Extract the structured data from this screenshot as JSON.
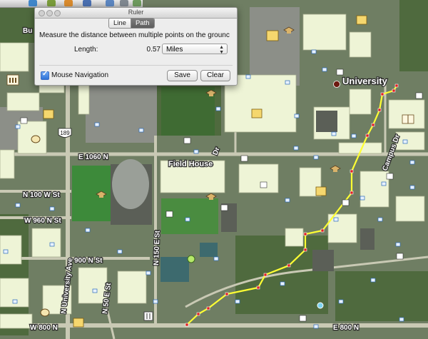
{
  "ruler": {
    "title": "Ruler",
    "tabs": [
      {
        "label": "Line",
        "active": false
      },
      {
        "label": "Path",
        "active": true
      }
    ],
    "description": "Measure the distance between multiple points on the grounc",
    "length_label": "Length:",
    "length_value": "0.57",
    "units_selected": "Miles",
    "mouse_navigation_label": "Mouse Navigation",
    "mouse_navigation_checked": true,
    "save_label": "Save",
    "clear_label": "Clear"
  },
  "map": {
    "place_labels": {
      "university": "University",
      "field_house": "Field House",
      "campus_dr": "Campus Dr",
      "byu_fragment": "Bu",
      "route_shield": "189"
    },
    "streets": {
      "e1060n": "E 1060 N",
      "n100w": "N 100 W St",
      "w960n": "W 960 N St",
      "n900n": "900 N St",
      "w800n": "W 800 N",
      "e800n": "E 800 N",
      "n_university_ave": "N University Ave",
      "n50e": "N 50 E St",
      "n150e": "N 150 E St",
      "n_dr_frag": "Dr"
    },
    "path_color": "#ffff33",
    "path_vertex_color": "#e02020"
  },
  "colors": {
    "panel_bg": "#ededed",
    "map_green": "#5d7a4a",
    "highlight_building": "#f2f7dc"
  }
}
